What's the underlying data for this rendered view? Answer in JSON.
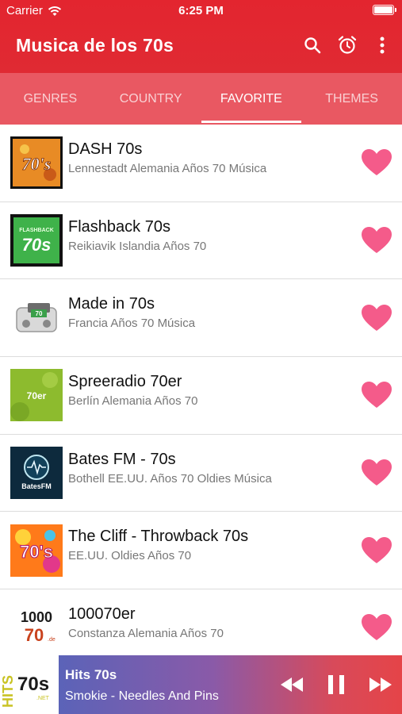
{
  "status_bar": {
    "carrier": "Carrier",
    "time": "6:25 PM"
  },
  "app_bar": {
    "title": "Musica de los 70s",
    "icons": [
      "search-icon",
      "alarm-clock-icon",
      "more-vertical-icon"
    ]
  },
  "tabs": [
    {
      "label": "GENRES",
      "active": false
    },
    {
      "label": "COUNTRY",
      "active": false
    },
    {
      "label": "FAVORITE",
      "active": true
    },
    {
      "label": "THEMES",
      "active": false
    }
  ],
  "stations": [
    {
      "name": "DASH 70s",
      "description": "Lennestadt Alemania Años 70 Música",
      "logo_text": "70's",
      "favorite": true
    },
    {
      "name": "Flashback 70s",
      "description": "Reikiavik Islandia Años 70",
      "logo_text": "FLASHBACK 70s",
      "favorite": true
    },
    {
      "name": "Made in 70s",
      "description": "Francia Años 70 Música",
      "logo_text": "70",
      "favorite": true
    },
    {
      "name": "Spreeradio 70er",
      "description": "Berlín Alemania Años 70",
      "logo_text": "70er",
      "favorite": true
    },
    {
      "name": "Bates FM - 70s",
      "description": "Bothell EE.UU. Años 70 Oldies Música",
      "logo_text": "BatesFM",
      "favorite": true
    },
    {
      "name": "The Cliff - Throwback 70s",
      "description": "EE.UU. Oldies Años 70",
      "logo_text": "70's",
      "favorite": true
    },
    {
      "name": "100070er",
      "description": "Constanza Alemania Años 70",
      "logo_text": "1000 70",
      "favorite": true
    }
  ],
  "player": {
    "station": "Hits 70s",
    "track": "Smokie - Needles And Pins",
    "logo_text": "HITS 70s",
    "controls": [
      "rewind-icon",
      "pause-icon",
      "fast-forward-icon"
    ]
  },
  "colors": {
    "primary": "#e3252f",
    "tabs_bg": "#e95862",
    "heart": "#f45b8a"
  }
}
